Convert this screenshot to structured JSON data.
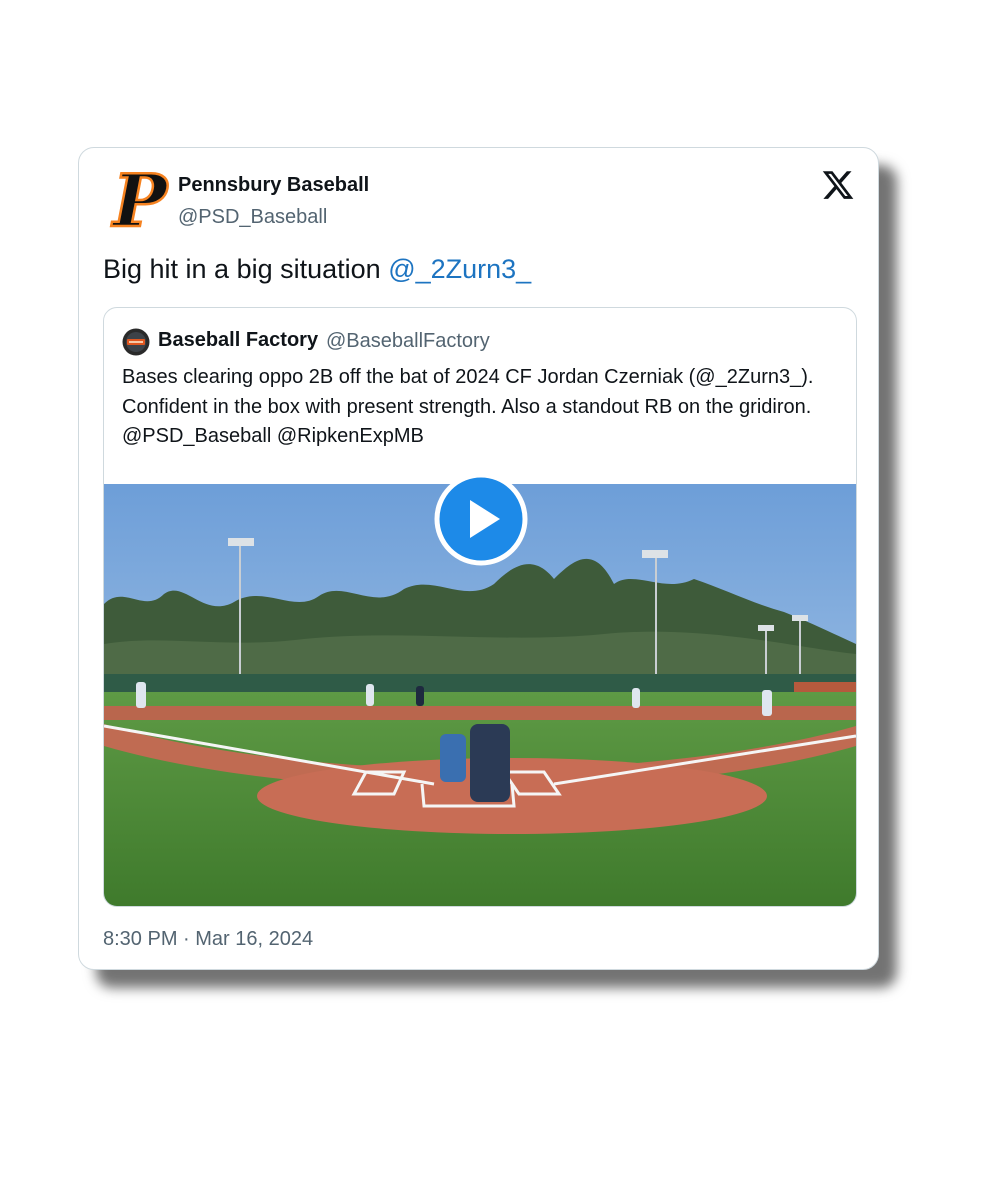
{
  "tweet": {
    "author_name": "Pennsbury Baseball",
    "author_handle": "@PSD_Baseball",
    "text": "Big hit in a big situation ",
    "mention": "@_2Zurn3_",
    "timestamp": "8:30 PM · Mar 16, 2024",
    "logo_icon": "x-logo-icon",
    "avatar_letter": "P"
  },
  "quoted_tweet": {
    "author_name": "Baseball Factory",
    "author_handle": "@BaseballFactory",
    "text": "Bases clearing oppo 2B off the bat of 2024 CF Jordan Czerniak (@_2Zurn3_). Confident in the box with present strength. Also a standout RB on the gridiron. @PSD_Baseball @RipkenExpMB",
    "media": {
      "type": "video",
      "description_icon": "play-icon"
    }
  },
  "colors": {
    "link": "#1d74c1",
    "secondary_text": "#536471",
    "play_button": "#1d8ae8",
    "avatar_orange": "#f58220"
  }
}
